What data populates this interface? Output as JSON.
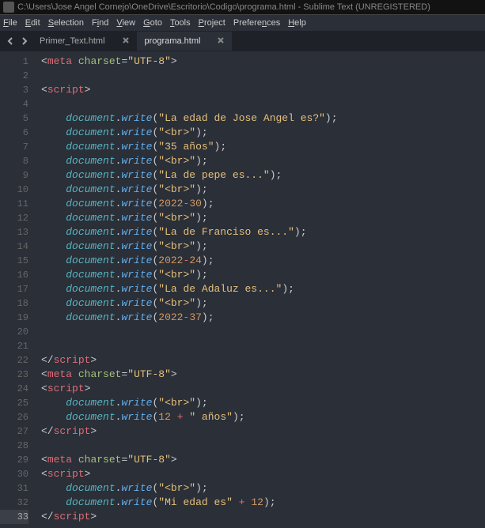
{
  "title": "C:\\Users\\Jose Angel Cornejo\\OneDrive\\Escritorio\\Codigo\\programa.html - Sublime Text (UNREGISTERED)",
  "menu": {
    "file": "File",
    "edit": "Edit",
    "selection": "Selection",
    "find": "Find",
    "view": "View",
    "goto": "Goto",
    "tools": "Tools",
    "project": "Project",
    "preferences": "Preferences",
    "help": "Help"
  },
  "tabs": [
    {
      "label": "Primer_Text.html",
      "active": false
    },
    {
      "label": "programa.html",
      "active": true
    }
  ],
  "lines": [
    {
      "n": 1,
      "i": 0,
      "t": [
        {
          "c": "punct",
          "v": "<"
        },
        {
          "c": "tag",
          "v": "meta"
        },
        {
          "c": "plain",
          "v": " "
        },
        {
          "c": "attr",
          "v": "charset"
        },
        {
          "c": "punct",
          "v": "="
        },
        {
          "c": "str",
          "v": "\"UTF-8\""
        },
        {
          "c": "punct",
          "v": ">"
        }
      ]
    },
    {
      "n": 2,
      "i": 0,
      "t": []
    },
    {
      "n": 3,
      "i": 0,
      "t": [
        {
          "c": "punct",
          "v": "<"
        },
        {
          "c": "tag",
          "v": "script"
        },
        {
          "c": "punct",
          "v": ">"
        }
      ]
    },
    {
      "n": 4,
      "i": 0,
      "t": []
    },
    {
      "n": 5,
      "i": 1,
      "t": [
        {
          "c": "ident",
          "v": "document"
        },
        {
          "c": "dot",
          "v": "."
        },
        {
          "c": "method",
          "v": "write"
        },
        {
          "c": "paren",
          "v": "("
        },
        {
          "c": "str",
          "v": "\"La edad de Jose Angel es?\""
        },
        {
          "c": "paren",
          "v": ")"
        },
        {
          "c": "punct",
          "v": ";"
        }
      ]
    },
    {
      "n": 6,
      "i": 1,
      "t": [
        {
          "c": "ident",
          "v": "document"
        },
        {
          "c": "dot",
          "v": "."
        },
        {
          "c": "method",
          "v": "write"
        },
        {
          "c": "paren",
          "v": "("
        },
        {
          "c": "str",
          "v": "\"<br>\""
        },
        {
          "c": "paren",
          "v": ")"
        },
        {
          "c": "punct",
          "v": ";"
        }
      ]
    },
    {
      "n": 7,
      "i": 1,
      "t": [
        {
          "c": "ident",
          "v": "document"
        },
        {
          "c": "dot",
          "v": "."
        },
        {
          "c": "method",
          "v": "write"
        },
        {
          "c": "paren",
          "v": "("
        },
        {
          "c": "str",
          "v": "\"35 años\""
        },
        {
          "c": "paren",
          "v": ")"
        },
        {
          "c": "punct",
          "v": ";"
        }
      ]
    },
    {
      "n": 8,
      "i": 1,
      "t": [
        {
          "c": "ident",
          "v": "document"
        },
        {
          "c": "dot",
          "v": "."
        },
        {
          "c": "method",
          "v": "write"
        },
        {
          "c": "paren",
          "v": "("
        },
        {
          "c": "str",
          "v": "\"<br>\""
        },
        {
          "c": "paren",
          "v": ")"
        },
        {
          "c": "punct",
          "v": ";"
        }
      ]
    },
    {
      "n": 9,
      "i": 1,
      "t": [
        {
          "c": "ident",
          "v": "document"
        },
        {
          "c": "dot",
          "v": "."
        },
        {
          "c": "method",
          "v": "write"
        },
        {
          "c": "paren",
          "v": "("
        },
        {
          "c": "str",
          "v": "\"La de pepe es...\""
        },
        {
          "c": "paren",
          "v": ")"
        },
        {
          "c": "punct",
          "v": ";"
        }
      ]
    },
    {
      "n": 10,
      "i": 1,
      "t": [
        {
          "c": "ident",
          "v": "document"
        },
        {
          "c": "dot",
          "v": "."
        },
        {
          "c": "method",
          "v": "write"
        },
        {
          "c": "paren",
          "v": "("
        },
        {
          "c": "str",
          "v": "\"<br>\""
        },
        {
          "c": "paren",
          "v": ")"
        },
        {
          "c": "punct",
          "v": ";"
        }
      ]
    },
    {
      "n": 11,
      "i": 1,
      "t": [
        {
          "c": "ident",
          "v": "document"
        },
        {
          "c": "dot",
          "v": "."
        },
        {
          "c": "method",
          "v": "write"
        },
        {
          "c": "paren",
          "v": "("
        },
        {
          "c": "num",
          "v": "2022"
        },
        {
          "c": "op",
          "v": "-"
        },
        {
          "c": "num",
          "v": "30"
        },
        {
          "c": "paren",
          "v": ")"
        },
        {
          "c": "punct",
          "v": ";"
        }
      ]
    },
    {
      "n": 12,
      "i": 1,
      "t": [
        {
          "c": "ident",
          "v": "document"
        },
        {
          "c": "dot",
          "v": "."
        },
        {
          "c": "method",
          "v": "write"
        },
        {
          "c": "paren",
          "v": "("
        },
        {
          "c": "str",
          "v": "\"<br>\""
        },
        {
          "c": "paren",
          "v": ")"
        },
        {
          "c": "punct",
          "v": ";"
        }
      ]
    },
    {
      "n": 13,
      "i": 1,
      "t": [
        {
          "c": "ident",
          "v": "document"
        },
        {
          "c": "dot",
          "v": "."
        },
        {
          "c": "method",
          "v": "write"
        },
        {
          "c": "paren",
          "v": "("
        },
        {
          "c": "str",
          "v": "\"La de Franciso es...\""
        },
        {
          "c": "paren",
          "v": ")"
        },
        {
          "c": "punct",
          "v": ";"
        }
      ]
    },
    {
      "n": 14,
      "i": 1,
      "t": [
        {
          "c": "ident",
          "v": "document"
        },
        {
          "c": "dot",
          "v": "."
        },
        {
          "c": "method",
          "v": "write"
        },
        {
          "c": "paren",
          "v": "("
        },
        {
          "c": "str",
          "v": "\"<br>\""
        },
        {
          "c": "paren",
          "v": ")"
        },
        {
          "c": "punct",
          "v": ";"
        }
      ]
    },
    {
      "n": 15,
      "i": 1,
      "t": [
        {
          "c": "ident",
          "v": "document"
        },
        {
          "c": "dot",
          "v": "."
        },
        {
          "c": "method",
          "v": "write"
        },
        {
          "c": "paren",
          "v": "("
        },
        {
          "c": "num",
          "v": "2022"
        },
        {
          "c": "op",
          "v": "-"
        },
        {
          "c": "num",
          "v": "24"
        },
        {
          "c": "paren",
          "v": ")"
        },
        {
          "c": "punct",
          "v": ";"
        }
      ]
    },
    {
      "n": 16,
      "i": 1,
      "t": [
        {
          "c": "ident",
          "v": "document"
        },
        {
          "c": "dot",
          "v": "."
        },
        {
          "c": "method",
          "v": "write"
        },
        {
          "c": "paren",
          "v": "("
        },
        {
          "c": "str",
          "v": "\"<br>\""
        },
        {
          "c": "paren",
          "v": ")"
        },
        {
          "c": "punct",
          "v": ";"
        }
      ]
    },
    {
      "n": 17,
      "i": 1,
      "t": [
        {
          "c": "ident",
          "v": "document"
        },
        {
          "c": "dot",
          "v": "."
        },
        {
          "c": "method",
          "v": "write"
        },
        {
          "c": "paren",
          "v": "("
        },
        {
          "c": "str",
          "v": "\"La de Adaluz es...\""
        },
        {
          "c": "paren",
          "v": ")"
        },
        {
          "c": "punct",
          "v": ";"
        }
      ]
    },
    {
      "n": 18,
      "i": 1,
      "t": [
        {
          "c": "ident",
          "v": "document"
        },
        {
          "c": "dot",
          "v": "."
        },
        {
          "c": "method",
          "v": "write"
        },
        {
          "c": "paren",
          "v": "("
        },
        {
          "c": "str",
          "v": "\"<br>\""
        },
        {
          "c": "paren",
          "v": ")"
        },
        {
          "c": "punct",
          "v": ";"
        }
      ]
    },
    {
      "n": 19,
      "i": 1,
      "t": [
        {
          "c": "ident",
          "v": "document"
        },
        {
          "c": "dot",
          "v": "."
        },
        {
          "c": "method",
          "v": "write"
        },
        {
          "c": "paren",
          "v": "("
        },
        {
          "c": "num",
          "v": "2022"
        },
        {
          "c": "op",
          "v": "-"
        },
        {
          "c": "num",
          "v": "37"
        },
        {
          "c": "paren",
          "v": ")"
        },
        {
          "c": "punct",
          "v": ";"
        }
      ]
    },
    {
      "n": 20,
      "i": 0,
      "t": []
    },
    {
      "n": 21,
      "i": 0,
      "t": []
    },
    {
      "n": 22,
      "i": 0,
      "t": [
        {
          "c": "punct",
          "v": "</"
        },
        {
          "c": "tag",
          "v": "script"
        },
        {
          "c": "punct",
          "v": ">"
        }
      ]
    },
    {
      "n": 23,
      "i": 0,
      "t": [
        {
          "c": "punct",
          "v": "<"
        },
        {
          "c": "tag",
          "v": "meta"
        },
        {
          "c": "plain",
          "v": " "
        },
        {
          "c": "attr",
          "v": "charset"
        },
        {
          "c": "punct",
          "v": "="
        },
        {
          "c": "str",
          "v": "\"UTF-8\""
        },
        {
          "c": "punct",
          "v": ">"
        }
      ]
    },
    {
      "n": 24,
      "i": 0,
      "t": [
        {
          "c": "punct",
          "v": "<"
        },
        {
          "c": "tag",
          "v": "script"
        },
        {
          "c": "punct",
          "v": ">"
        }
      ]
    },
    {
      "n": 25,
      "i": 1,
      "t": [
        {
          "c": "ident",
          "v": "document"
        },
        {
          "c": "dot",
          "v": "."
        },
        {
          "c": "method",
          "v": "write"
        },
        {
          "c": "paren",
          "v": "("
        },
        {
          "c": "str",
          "v": "\"<br>\""
        },
        {
          "c": "paren",
          "v": ")"
        },
        {
          "c": "punct",
          "v": ";"
        }
      ]
    },
    {
      "n": 26,
      "i": 1,
      "t": [
        {
          "c": "ident",
          "v": "document"
        },
        {
          "c": "dot",
          "v": "."
        },
        {
          "c": "method",
          "v": "write"
        },
        {
          "c": "paren",
          "v": "("
        },
        {
          "c": "num",
          "v": "12"
        },
        {
          "c": "plain",
          "v": " "
        },
        {
          "c": "op",
          "v": "+"
        },
        {
          "c": "plain",
          "v": " "
        },
        {
          "c": "str",
          "v": "\" años\""
        },
        {
          "c": "paren",
          "v": ")"
        },
        {
          "c": "punct",
          "v": ";"
        }
      ]
    },
    {
      "n": 27,
      "i": 0,
      "t": [
        {
          "c": "punct",
          "v": "</"
        },
        {
          "c": "tag",
          "v": "script"
        },
        {
          "c": "punct",
          "v": ">"
        }
      ]
    },
    {
      "n": 28,
      "i": 0,
      "t": []
    },
    {
      "n": 29,
      "i": 0,
      "t": [
        {
          "c": "punct",
          "v": "<"
        },
        {
          "c": "tag",
          "v": "meta"
        },
        {
          "c": "plain",
          "v": " "
        },
        {
          "c": "attr",
          "v": "charset"
        },
        {
          "c": "punct",
          "v": "="
        },
        {
          "c": "str",
          "v": "\"UTF-8\""
        },
        {
          "c": "punct",
          "v": ">"
        }
      ]
    },
    {
      "n": 30,
      "i": 0,
      "t": [
        {
          "c": "punct",
          "v": "<"
        },
        {
          "c": "tag",
          "v": "script"
        },
        {
          "c": "punct",
          "v": ">"
        }
      ]
    },
    {
      "n": 31,
      "i": 1,
      "t": [
        {
          "c": "ident",
          "v": "document"
        },
        {
          "c": "dot",
          "v": "."
        },
        {
          "c": "method",
          "v": "write"
        },
        {
          "c": "paren",
          "v": "("
        },
        {
          "c": "str",
          "v": "\"<br>\""
        },
        {
          "c": "paren",
          "v": ")"
        },
        {
          "c": "punct",
          "v": ";"
        }
      ]
    },
    {
      "n": 32,
      "i": 1,
      "t": [
        {
          "c": "ident",
          "v": "document"
        },
        {
          "c": "dot",
          "v": "."
        },
        {
          "c": "method",
          "v": "write"
        },
        {
          "c": "paren",
          "v": "("
        },
        {
          "c": "str",
          "v": "\"Mi edad es\""
        },
        {
          "c": "plain",
          "v": " "
        },
        {
          "c": "op",
          "v": "+"
        },
        {
          "c": "plain",
          "v": " "
        },
        {
          "c": "num",
          "v": "12"
        },
        {
          "c": "paren",
          "v": ")"
        },
        {
          "c": "punct",
          "v": ";"
        }
      ]
    },
    {
      "n": 33,
      "i": 0,
      "cur": true,
      "t": [
        {
          "c": "punct",
          "v": "</"
        },
        {
          "c": "tag",
          "v": "script"
        },
        {
          "c": "punct",
          "v": ">"
        }
      ]
    }
  ]
}
